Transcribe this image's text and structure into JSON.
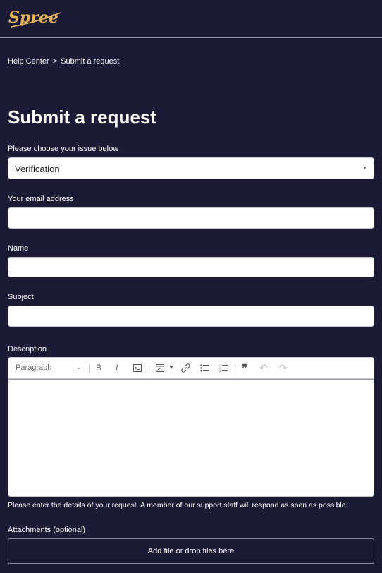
{
  "brand": {
    "logo_text": "Spree"
  },
  "breadcrumb": {
    "home": "Help Center",
    "separator": ">",
    "current": "Submit a request"
  },
  "page": {
    "title": "Submit a request"
  },
  "form": {
    "issue_label": "Please choose your issue below",
    "issue_value": "Verification",
    "email_label": "Your email address",
    "email_value": "",
    "name_label": "Name",
    "name_value": "",
    "subject_label": "Subject",
    "subject_value": "",
    "description_label": "Description",
    "paragraph_style": "Paragraph",
    "description_hint": "Please enter the details of your request. A member of our support staff will respond as soon as possible.",
    "attachments_label": "Attachments (optional)",
    "attachments_button": "Add file or drop files here"
  },
  "toolbar_icons": [
    "bold-icon",
    "italic-icon",
    "code-icon",
    "code-block-icon",
    "link-icon",
    "bulleted-list-icon",
    "numbered-list-icon",
    "blockquote-icon",
    "undo-icon",
    "redo-icon"
  ],
  "colors": {
    "background": "#1c1b36",
    "field": "#ffffff",
    "logo_gold": "#e4b45a"
  }
}
